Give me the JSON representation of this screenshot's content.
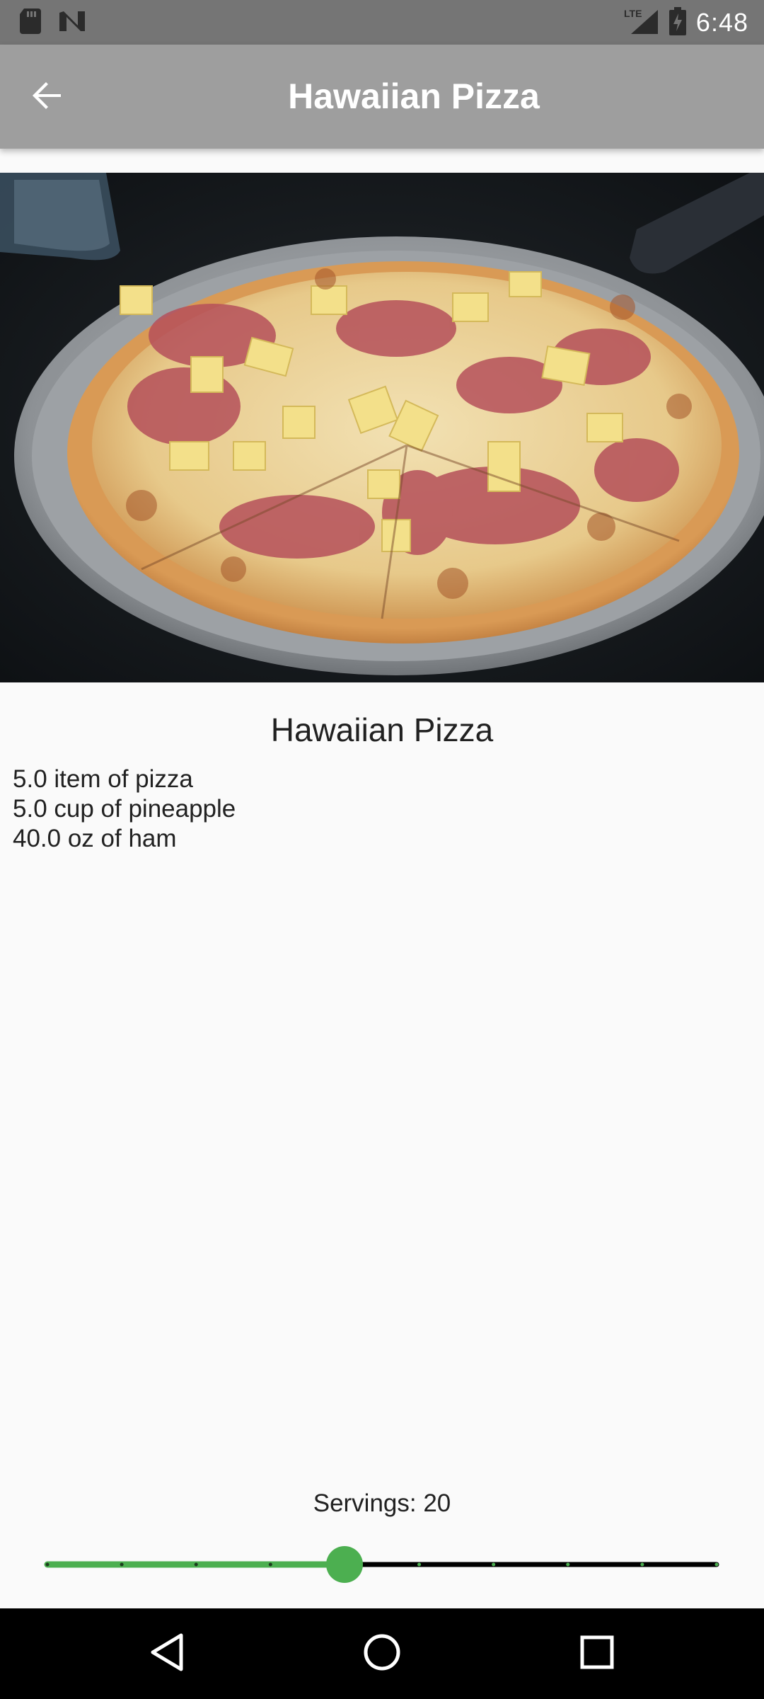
{
  "status_bar": {
    "time": "6:48",
    "network": "LTE",
    "icons": [
      "sd-card-icon",
      "n-notification-icon",
      "lte-signal-icon",
      "battery-icon"
    ]
  },
  "app_bar": {
    "title": "Hawaiian Pizza",
    "back_icon": "arrow-back-icon"
  },
  "hero_image": {
    "subject": "pizza-photo"
  },
  "recipe": {
    "title": "Hawaiian Pizza",
    "ingredients": [
      "5.0 item of pizza",
      "5.0 cup of pineapple",
      "40.0 oz of ham"
    ]
  },
  "servings": {
    "label": "Servings: 20",
    "value": 20,
    "level_fraction": 0.444,
    "divisions": 9,
    "accent_color": "#4caf50",
    "inactive_color": "#000000"
  },
  "nav_bar": {
    "icons": [
      "nav-back-icon",
      "nav-home-icon",
      "nav-recents-icon"
    ]
  },
  "colors": {
    "status_bar": "#757575",
    "app_bar": "#9e9e9e",
    "background": "#fafafa",
    "nav_bar": "#000000"
  }
}
